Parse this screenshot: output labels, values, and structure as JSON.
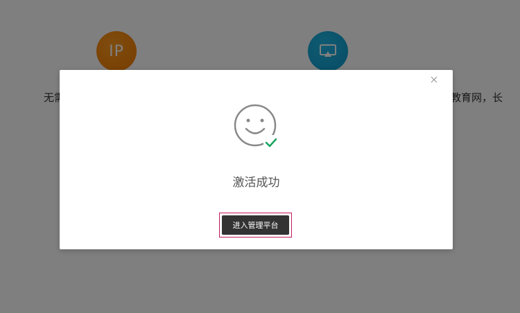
{
  "background": {
    "features": [
      {
        "icon": "ip-icon",
        "icon_text": "IP",
        "color": "#f5890f",
        "text": "无需"
      },
      {
        "icon": "screen-cast-icon",
        "color": "#1aa6d8",
        "text": "支持教育网，长"
      }
    ]
  },
  "dialog": {
    "status_icon": "smiley-check-icon",
    "success_text": "激活成功",
    "enter_button_label": "进入管理平台",
    "close_icon": "close-icon"
  },
  "colors": {
    "overlay": "rgba(0,0,0,0.5)",
    "button_bg": "#333333",
    "check_green": "#19a35f",
    "highlight_border": "#c2185b"
  }
}
